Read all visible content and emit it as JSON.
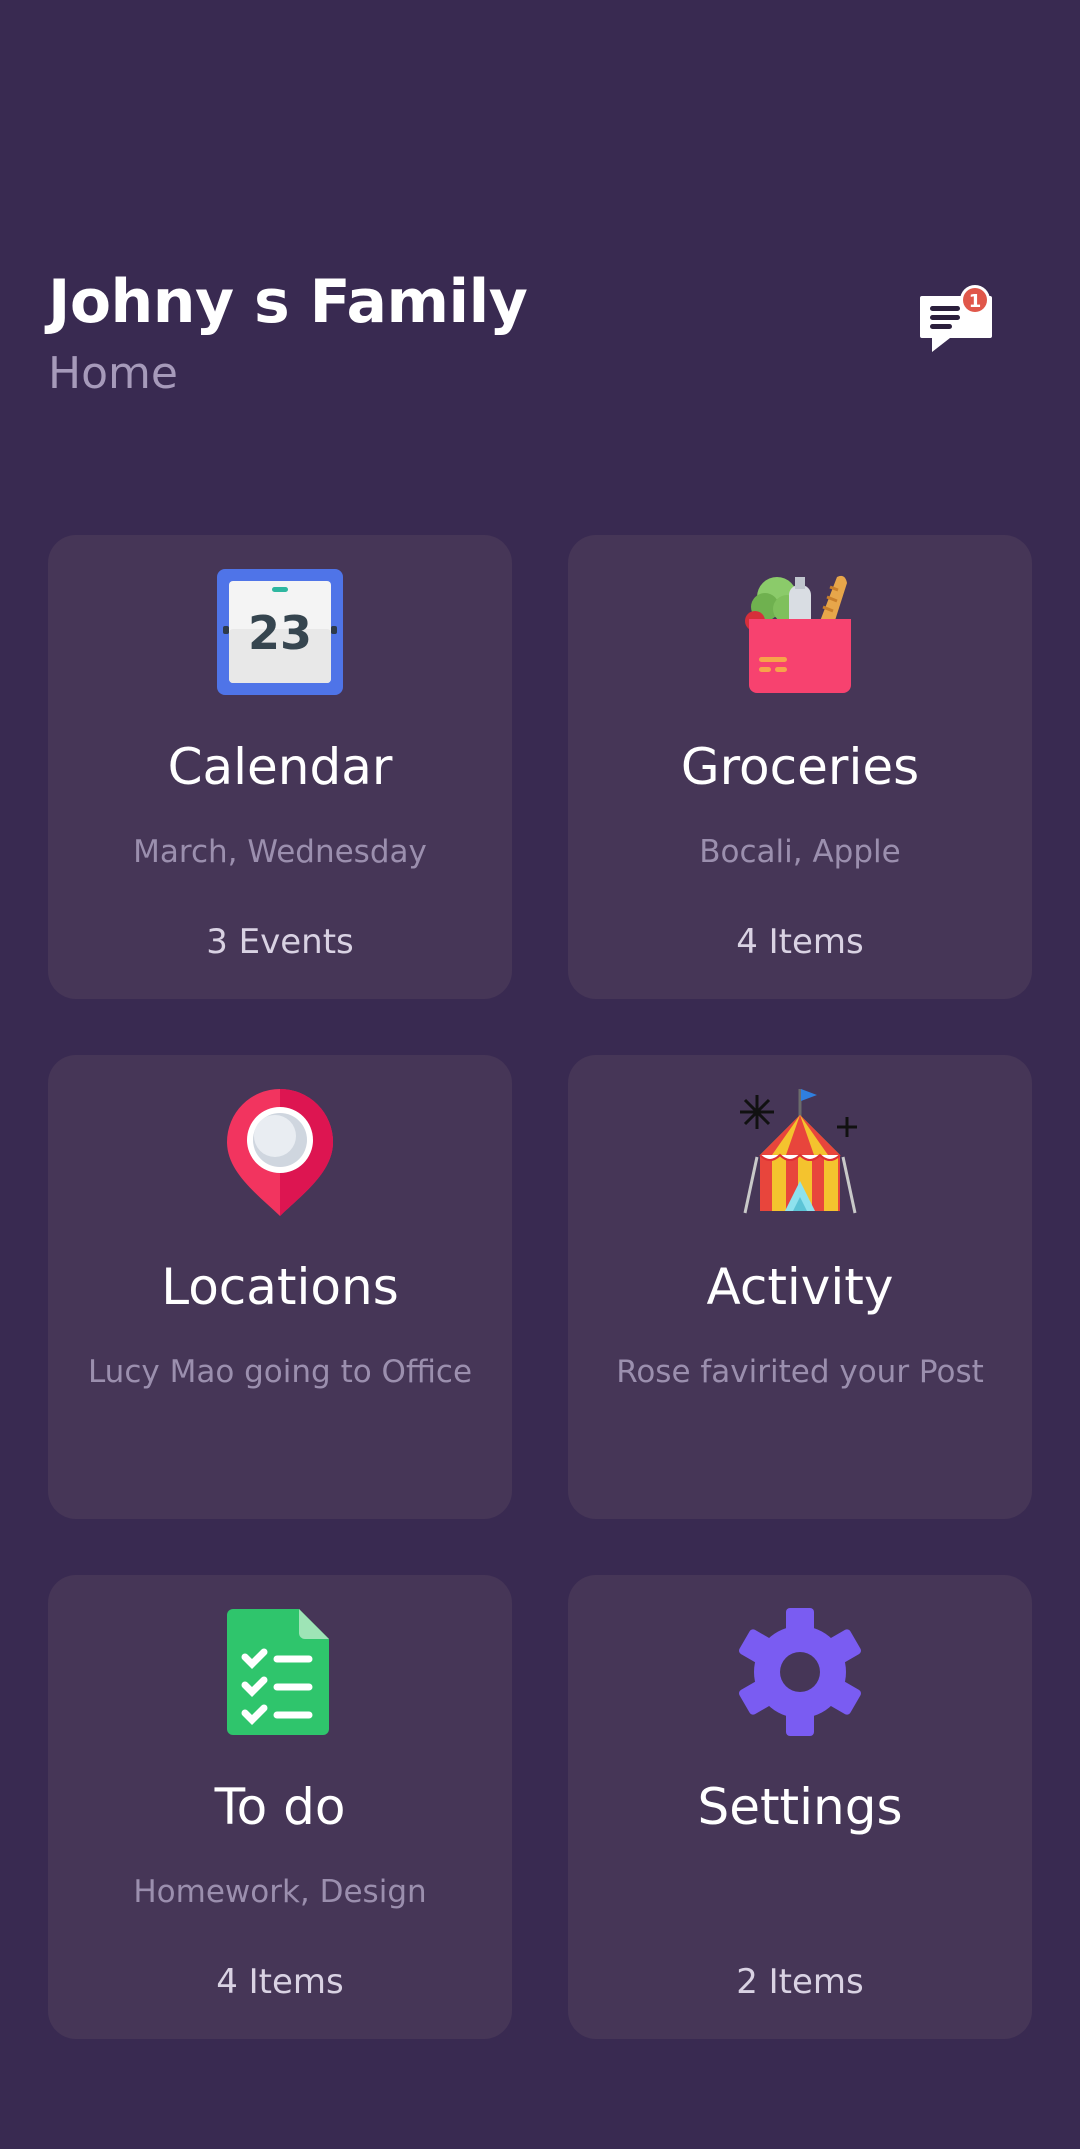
{
  "header": {
    "title": "Johny s Family",
    "subtitle": "Home",
    "messages_badge": "1"
  },
  "cards": [
    {
      "title": "Calendar",
      "subtitle": "March, Wednesday",
      "count": "3 Events",
      "icon": "calendar-icon",
      "icon_text": "23"
    },
    {
      "title": "Groceries",
      "subtitle": "Bocali, Apple",
      "count": "4 Items",
      "icon": "grocery-bag-icon"
    },
    {
      "title": "Locations",
      "subtitle": "Lucy Mao going to Office",
      "count": "",
      "icon": "location-pin-icon"
    },
    {
      "title": "Activity",
      "subtitle": "Rose favirited your Post",
      "count": "",
      "icon": "circus-tent-icon"
    },
    {
      "title": "To do",
      "subtitle": "Homework, Design",
      "count": "4 Items",
      "icon": "checklist-icon"
    },
    {
      "title": "Settings",
      "subtitle": "",
      "count": "2 Items",
      "icon": "gear-icon"
    }
  ],
  "colors": {
    "background": "#392a51",
    "card": "#463657",
    "subtitle": "#a69aba",
    "badge": "#e0574a"
  }
}
